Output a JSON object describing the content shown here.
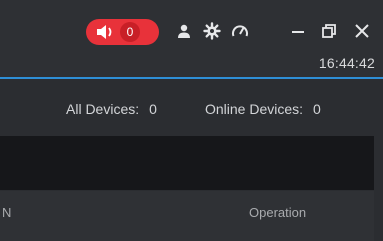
{
  "titlebar": {
    "alarm": {
      "count": "0",
      "icon": "speaker-icon",
      "color": "#e8323a"
    },
    "icons": [
      "user-icon",
      "gear-icon",
      "gauge-icon",
      "minimize-icon",
      "restore-icon",
      "close-icon"
    ],
    "clock": "16:44:42",
    "accent_color": "#2e8ed6"
  },
  "counts": {
    "all_label": "All Devices:",
    "all_value": "0",
    "online_label": "Online Devices:",
    "online_value": "0"
  },
  "table": {
    "columns": [
      "N",
      "Operation"
    ]
  }
}
